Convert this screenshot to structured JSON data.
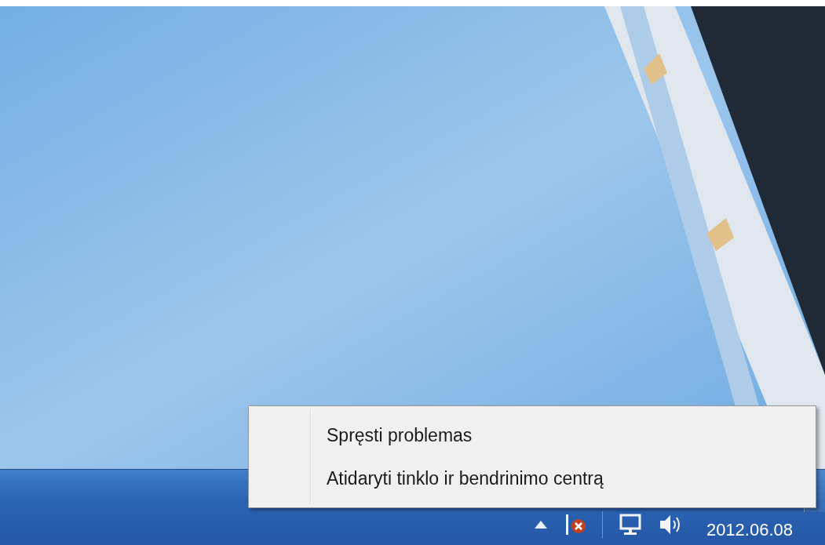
{
  "context_menu": {
    "items": [
      {
        "label": "Spręsti problemas"
      },
      {
        "label": "Atidaryti tinklo ir bendrinimo centrą"
      }
    ]
  },
  "taskbar": {
    "clock": {
      "date": "2012.06.08"
    }
  }
}
